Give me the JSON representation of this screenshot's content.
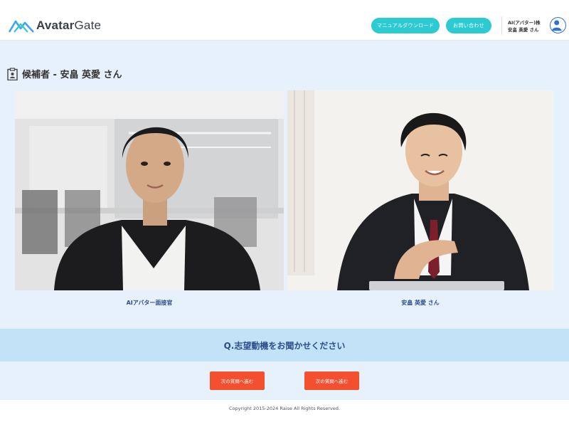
{
  "header": {
    "logo_text_bold": "Avatar",
    "logo_text_light": "Gate",
    "manual_button": "マニュアルダウンロード",
    "contact_button": "お問い合わせ",
    "company_name": "AI(アバター)株",
    "user_name": "安畠 英愛 さん"
  },
  "candidate": {
    "title": "候補者 - 安畠 英愛 さん"
  },
  "videos": {
    "interviewer_label": "AIアバター面接官",
    "candidate_label": "安畠 英愛 さん"
  },
  "question": {
    "text": "Q.志望動機をお聞かせください"
  },
  "actions": {
    "next_button_1": "次の質問へ進む",
    "next_button_2": "次の質問へ進む"
  },
  "footer": {
    "copyright": "Copyright 2015-2024 Raise All Rights Reserved."
  },
  "colors": {
    "accent": "#2ccad2",
    "primary_text": "#2d4e8c",
    "danger": "#f4502f",
    "main_bg": "#e6f1fb",
    "question_bg": "#c2e2f7"
  }
}
